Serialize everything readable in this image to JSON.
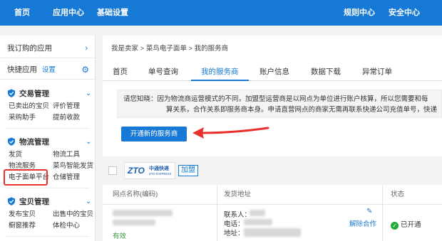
{
  "topnav": {
    "items": [
      "首页",
      "应用中心",
      "基础设置"
    ],
    "right": [
      "规则中心",
      "安全中心"
    ]
  },
  "sidebar": {
    "subscribed": "我订购的应用",
    "quick_apps": "快捷应用",
    "settings_link": "设置",
    "sections": [
      {
        "title": "交易管理",
        "icon": "trade-shield-icon",
        "links": [
          "已卖出的宝贝",
          "评价管理",
          "采购助手",
          "提前收款"
        ]
      },
      {
        "title": "物流管理",
        "icon": "logistics-shield-icon",
        "links": [
          "发货",
          "物流工具",
          "物流服务",
          "菜鸟智能发货",
          "电子面单平台",
          "仓储管理"
        ]
      },
      {
        "title": "宝贝管理",
        "icon": "goods-shield-icon",
        "links": [
          "发布宝贝",
          "出售中的宝贝",
          "橱窗推荐",
          "体检中心"
        ]
      }
    ]
  },
  "breadcrumb": "我是卖家 > 菜鸟电子面单 > 我的服务商",
  "tabs": [
    "首页",
    "单号查询",
    "我的服务商",
    "账户信息",
    "数据下载",
    "异常订单"
  ],
  "active_tab": "我的服务商",
  "notice": {
    "line1": "请您知晓：因为物流商运营模式的不同，加盟型运营商是以网点为单位进行账户核算，所以您需要和每",
    "line2": "算关系，合作关系即服务商本身。申请直营网点的商家无需再联系快递公司充值单号，快递"
  },
  "actions": {
    "open_new_provider": "开通新的服务商"
  },
  "provider": {
    "logo_text": "ZTO",
    "logo_cn": "中通快递",
    "logo_en": "ZTO EXPRESS",
    "type_tag": "加盟",
    "columns": [
      "网点名称(编码)",
      "发货地址",
      "状态"
    ],
    "row": {
      "status_text": "有效",
      "contact_label": "联系人：",
      "phone_label": "电话：",
      "address_label": "地址：",
      "cancel_label": "解除合作",
      "opened_label": "已开通"
    }
  },
  "colors": {
    "brand_blue": "#1679d6",
    "highlight_red": "#e8302c",
    "success_green": "#22ac38"
  }
}
